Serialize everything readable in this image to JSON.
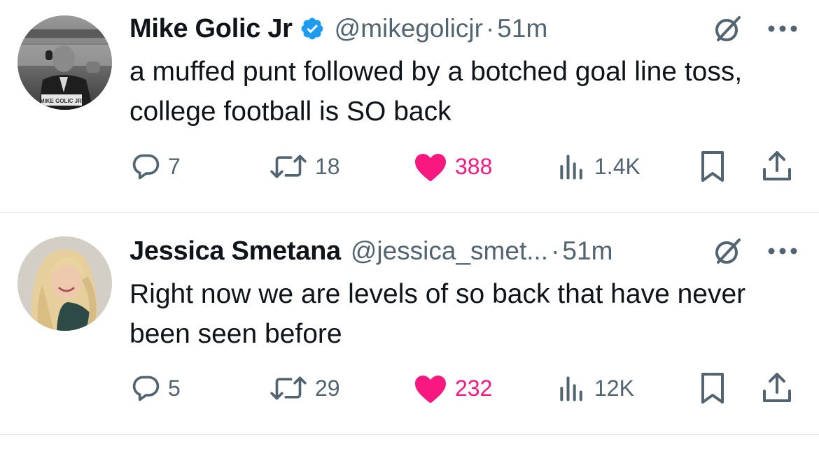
{
  "tweets": [
    {
      "display_name": "Mike Golic Jr",
      "verified": true,
      "handle": "@mikegolicjr",
      "separator": "·",
      "time": "51m",
      "text": "a muffed punt followed by a botched goal line toss, college football is SO back",
      "avatar_caption": "MIKE GOLIC JR.",
      "replies": "7",
      "retweets": "18",
      "likes": "388",
      "views": "1.4K",
      "liked": true
    },
    {
      "display_name": "Jessica Smetana",
      "verified": false,
      "handle": "@jessica_smet...",
      "separator": "·",
      "time": "51m",
      "text": "Right now we are levels of so back that have never been seen before",
      "replies": "5",
      "retweets": "29",
      "likes": "232",
      "views": "12K",
      "liked": true
    }
  ],
  "icons": {
    "reply": "reply-icon",
    "retweet": "retweet-icon",
    "like": "heart-icon",
    "views": "views-icon",
    "bookmark": "bookmark-icon",
    "share": "share-icon",
    "grok": "grok-icon",
    "more": "more-icon",
    "verified": "verified-badge-icon"
  },
  "colors": {
    "text": "#0f1419",
    "secondary": "#536471",
    "like": "#f91880",
    "verified": "#1d9bf0",
    "divider": "#e1e4e8"
  }
}
